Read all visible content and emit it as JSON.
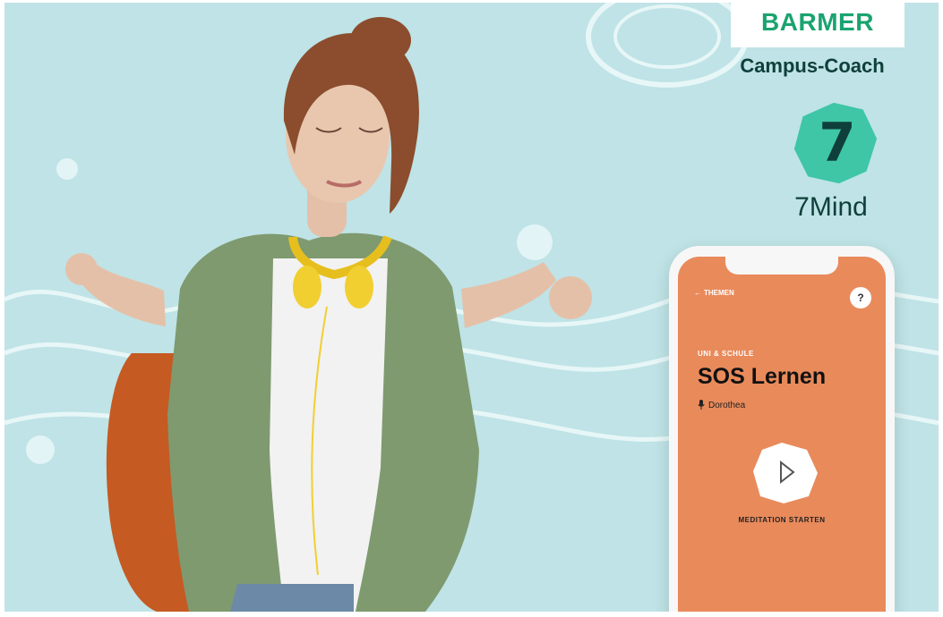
{
  "brand": {
    "name": "BARMER",
    "subtitle": "Campus-Coach"
  },
  "partner": {
    "badge_number": "7",
    "name": "7Mind"
  },
  "phone": {
    "back_label": "THEMEN",
    "help_label": "?",
    "category": "UNI & SCHULE",
    "title": "SOS Lernen",
    "speaker": "Dorothea",
    "action_label": "MEDITATION STARTEN"
  },
  "colors": {
    "background": "#bfe3e6",
    "brand_green": "#1aa36f",
    "partner_green": "#3ec6a6",
    "phone_orange": "#e98a5b"
  },
  "icons": [
    "back-arrow-icon",
    "help-icon",
    "microphone-icon",
    "play-icon"
  ]
}
